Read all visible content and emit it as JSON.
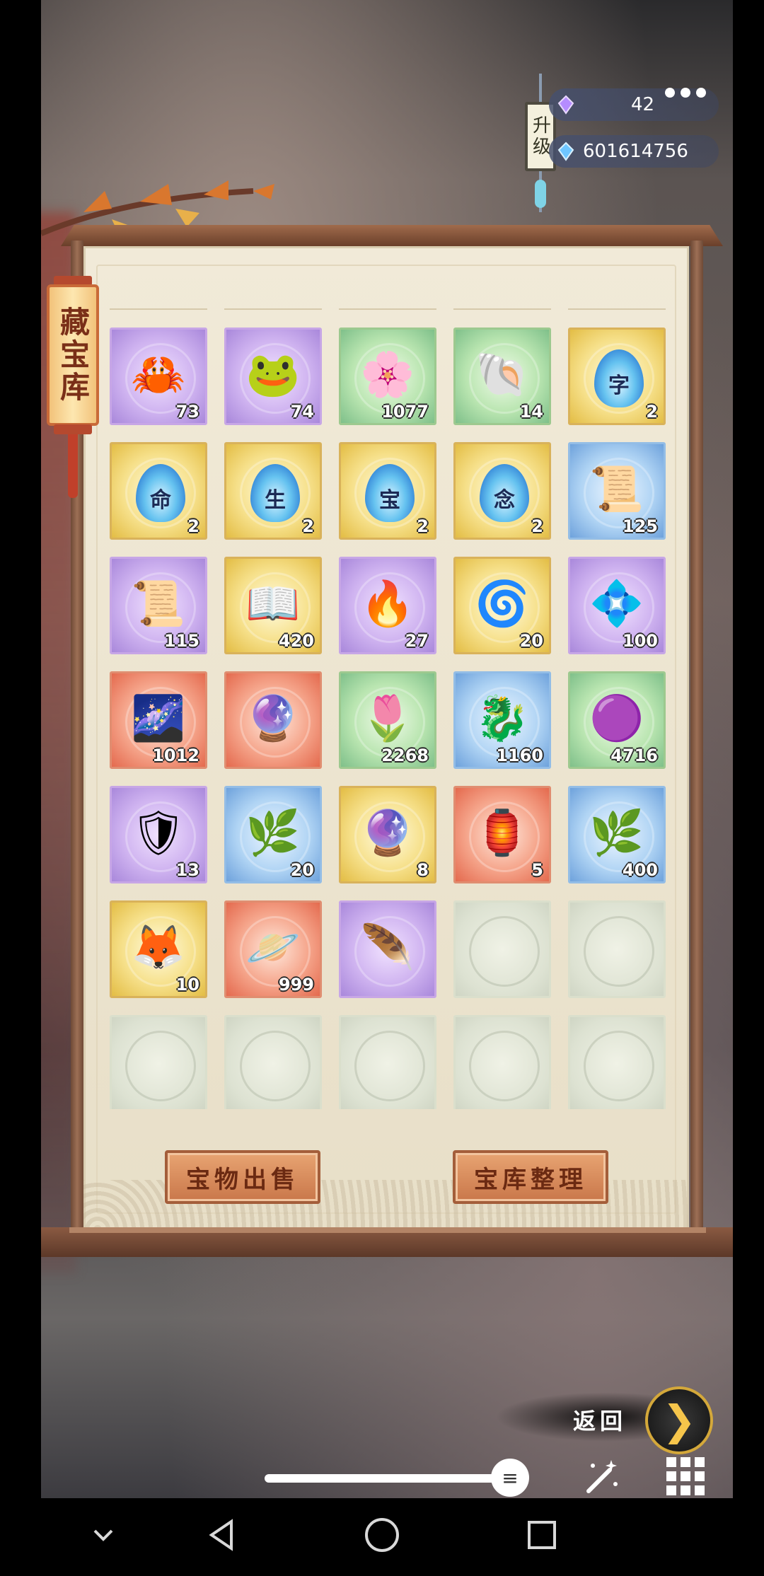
{
  "header": {
    "upgrade_label": "升级",
    "currency_1": {
      "icon": "purple-crystal-icon",
      "value": "42"
    },
    "currency_2": {
      "icon": "blue-crystal-icon",
      "value": "601614756"
    }
  },
  "title": "藏宝库",
  "items": [
    {
      "icon": "crab-icon",
      "rarity": "purple",
      "count": "73"
    },
    {
      "icon": "golden-toad-icon",
      "rarity": "purple",
      "count": "74"
    },
    {
      "icon": "white-flower-icon",
      "rarity": "green",
      "count": "1077"
    },
    {
      "icon": "snail-shell-icon",
      "rarity": "green",
      "count": "14"
    },
    {
      "icon": "blue-flame-icon",
      "rarity": "gold",
      "count": "2",
      "glyph": "字"
    },
    {
      "icon": "blue-flame-icon",
      "rarity": "gold",
      "count": "2",
      "glyph": "命"
    },
    {
      "icon": "blue-flame-icon",
      "rarity": "gold",
      "count": "2",
      "glyph": "生"
    },
    {
      "icon": "blue-flame-icon",
      "rarity": "gold",
      "count": "2",
      "glyph": "宝"
    },
    {
      "icon": "blue-flame-icon",
      "rarity": "gold",
      "count": "2",
      "glyph": "念"
    },
    {
      "icon": "scroll-icon",
      "rarity": "blue",
      "count": "125"
    },
    {
      "icon": "letter-scroll-icon",
      "rarity": "purple",
      "count": "115"
    },
    {
      "icon": "open-book-icon",
      "rarity": "gold",
      "count": "420"
    },
    {
      "icon": "fire-icon",
      "rarity": "purple",
      "count": "27"
    },
    {
      "icon": "purple-swirl-icon",
      "rarity": "gold",
      "count": "20"
    },
    {
      "icon": "dark-crystal-icon",
      "rarity": "purple",
      "count": "100"
    },
    {
      "icon": "galaxy-scroll-icon",
      "rarity": "red",
      "count": "1012"
    },
    {
      "icon": "pink-pearl-icon",
      "rarity": "red",
      "count": ""
    },
    {
      "icon": "crystal-flower-icon",
      "rarity": "green",
      "count": "2268"
    },
    {
      "icon": "dragon-icon",
      "rarity": "blue",
      "count": "1160"
    },
    {
      "icon": "purple-orb-icon",
      "rarity": "green",
      "count": "4716"
    },
    {
      "icon": "armor-icon",
      "rarity": "purple",
      "count": "13"
    },
    {
      "icon": "herb-icon",
      "rarity": "blue",
      "count": "20"
    },
    {
      "icon": "violet-sphere-icon",
      "rarity": "gold",
      "count": "8"
    },
    {
      "icon": "red-orb-icon",
      "rarity": "red",
      "count": "5"
    },
    {
      "icon": "herb-icon",
      "rarity": "blue",
      "count": "400"
    },
    {
      "icon": "golden-fox-icon",
      "rarity": "gold",
      "count": "10"
    },
    {
      "icon": "blue-ring-orb-icon",
      "rarity": "red",
      "count": "999"
    },
    {
      "icon": "golden-feather-icon",
      "rarity": "purple",
      "count": ""
    },
    {
      "icon": "",
      "rarity": "empty",
      "count": ""
    },
    {
      "icon": "",
      "rarity": "empty",
      "count": ""
    },
    {
      "icon": "",
      "rarity": "empty",
      "count": ""
    },
    {
      "icon": "",
      "rarity": "empty",
      "count": ""
    },
    {
      "icon": "",
      "rarity": "empty",
      "count": ""
    },
    {
      "icon": "",
      "rarity": "empty",
      "count": ""
    },
    {
      "icon": "",
      "rarity": "empty",
      "count": ""
    }
  ],
  "buttons": {
    "sell": "宝物出售",
    "sort": "宝库整理",
    "back": "返回"
  },
  "toolbar": {
    "slider_level": 0.92,
    "wand_icon": "magic-wand-icon",
    "grid_icon": "grid-menu-icon"
  },
  "navbar": [
    "chevron-down-icon",
    "back-triangle-icon",
    "home-circle-icon",
    "recents-square-icon"
  ]
}
